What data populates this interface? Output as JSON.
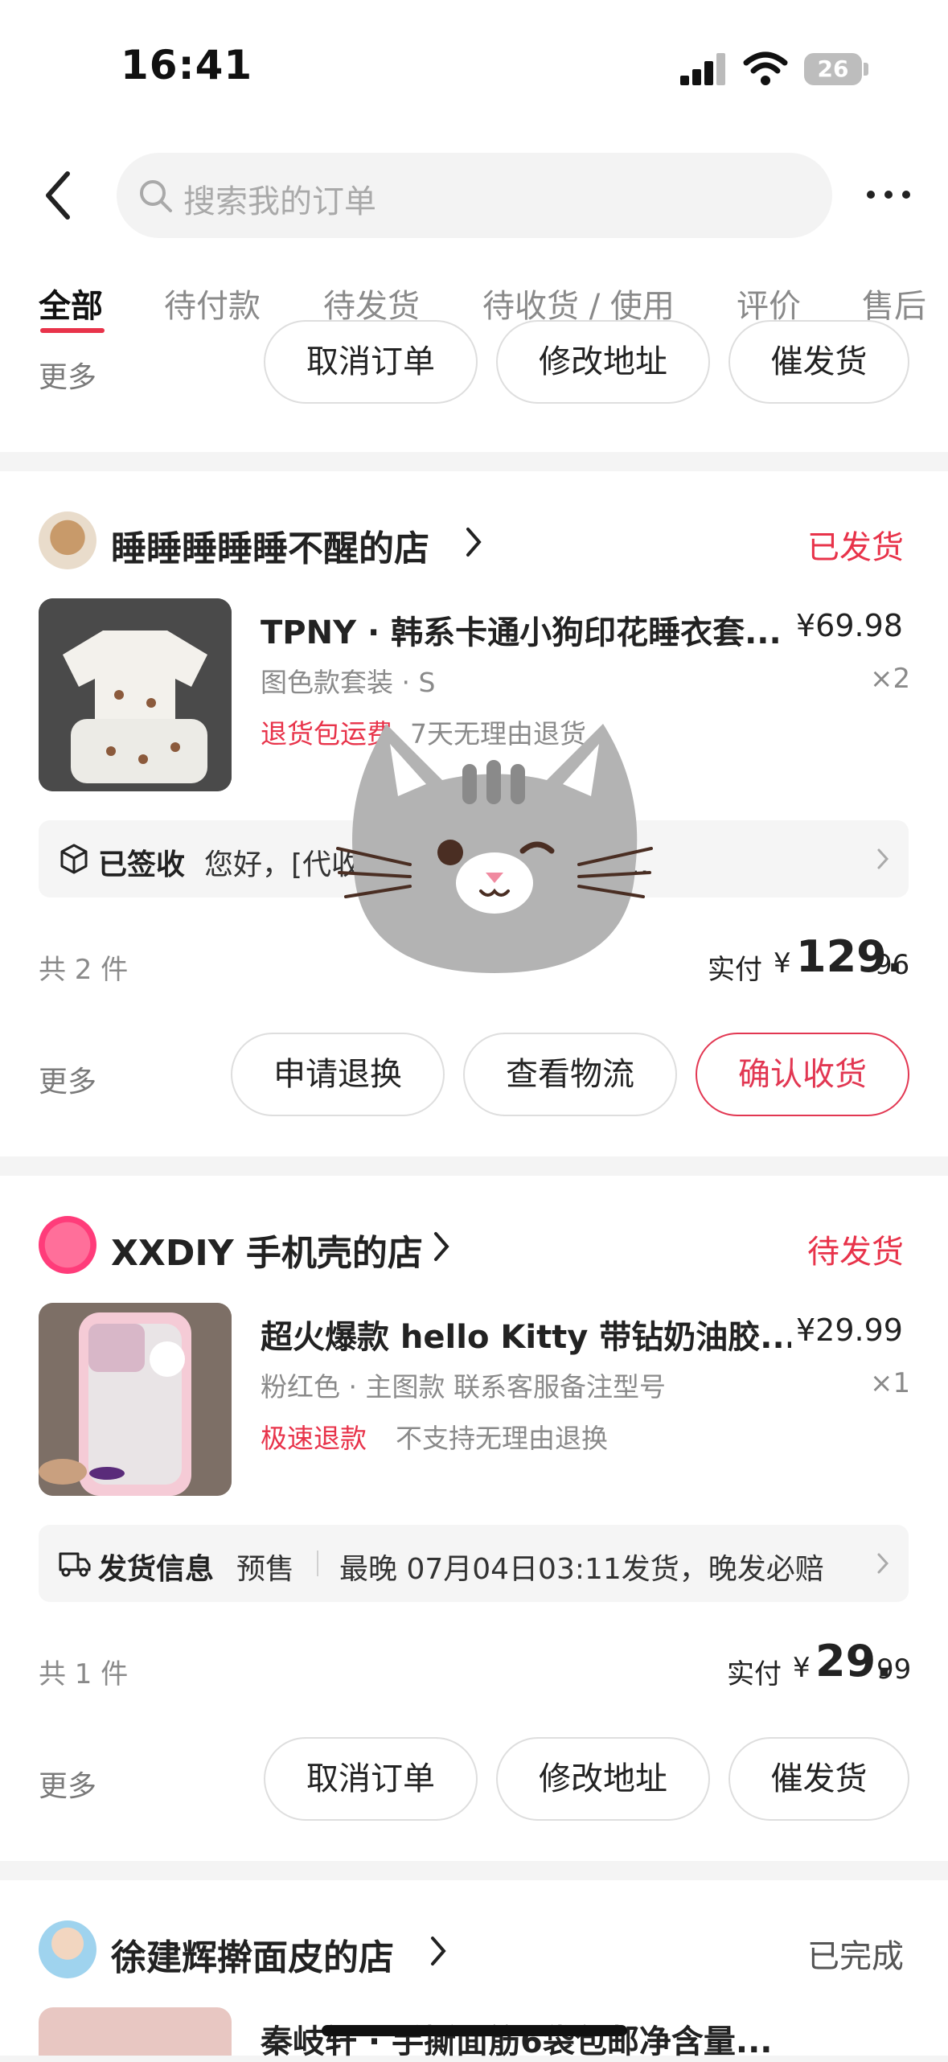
{
  "status_bar": {
    "time": "16:41",
    "battery": "26"
  },
  "header": {
    "search_placeholder": "搜索我的订单"
  },
  "tabs": [
    {
      "label": "全部"
    },
    {
      "label": "待付款"
    },
    {
      "label": "待发货"
    },
    {
      "label": "待收货 / 使用"
    },
    {
      "label": "评价"
    },
    {
      "label": "售后"
    }
  ],
  "top_partial_card": {
    "more": "更多",
    "buttons": [
      "取消订单",
      "修改地址",
      "催发货"
    ]
  },
  "orders": [
    {
      "shop": "睡睡睡睡睡不醒的店",
      "status": "已发货",
      "title": "TPNY · 韩系卡通小狗印花睡衣套...",
      "price": "¥69.98",
      "spec": "图色款套装 · S",
      "qty": "×2",
      "tags": [
        "退货包运费",
        "7天无理由退货"
      ],
      "info_label": "已签收",
      "info_text": "您好，[代收点] … 驿站已将快件...",
      "count": "共 2 件",
      "paid_label": "实付",
      "paid_currency": "¥",
      "paid_int": "129.",
      "paid_dec": "96",
      "more": "更多",
      "buttons": [
        "申请退换",
        "查看物流",
        "确认收货"
      ]
    },
    {
      "shop": "XXDIY 手机壳的店",
      "status": "待发货",
      "title": "超火爆款 hello Kitty 带钻奶油胶...",
      "price": "¥29.99",
      "spec": "粉红色 · 主图款 联系客服备注型号",
      "qty": "×1",
      "tags": [
        "极速退款",
        "不支持无理由退换"
      ],
      "info_label": "发货信息",
      "info_pre": "预售",
      "info_text": "最晚 07月04日03:11发货，晚发必赔",
      "count": "共 1 件",
      "paid_label": "实付",
      "paid_currency": "¥",
      "paid_int": "29.",
      "paid_dec": "99",
      "more": "更多",
      "buttons": [
        "取消订单",
        "修改地址",
        "催发货"
      ]
    },
    {
      "shop": "徐建辉擀面皮的店",
      "status": "已完成",
      "title": "秦岐轩 · 手撕面筋6袋包邮净含量..."
    }
  ],
  "colors": {
    "accent": "#e8334a",
    "background": "#f4f4f4"
  },
  "icons": [
    "back-arrow-icon",
    "search-icon",
    "more-dots-icon",
    "chevron-right-icon",
    "box-icon",
    "truck-icon",
    "cat-sticker-icon"
  ]
}
